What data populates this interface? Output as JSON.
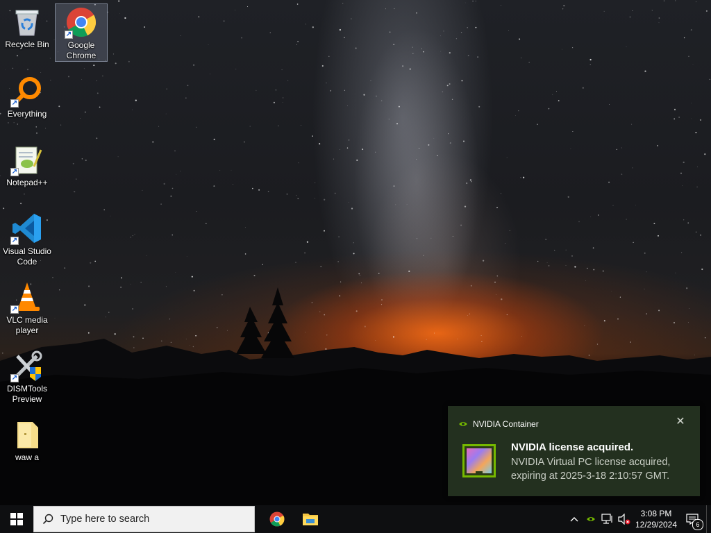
{
  "desktop": {
    "icons": [
      {
        "label": "Recycle Bin",
        "icon": "recycle-bin-icon"
      },
      {
        "label": "Google Chrome",
        "icon": "chrome-icon",
        "selected": true
      },
      {
        "label": "Everything",
        "icon": "everything-search-icon"
      },
      {
        "label": "Notepad++",
        "icon": "notepad-plus-plus-icon"
      },
      {
        "label": "Visual Studio Code",
        "icon": "vscode-icon"
      },
      {
        "label": "VLC media player",
        "icon": "vlc-icon"
      },
      {
        "label": "DISMTools Preview",
        "icon": "dismtools-icon"
      },
      {
        "label": "waw a",
        "icon": "folder-icon"
      }
    ]
  },
  "toast": {
    "app_name": "NVIDIA Container",
    "title": "NVIDIA license acquired.",
    "body": "NVIDIA Virtual PC license acquired, expiring at 2025-3-18 2:10:57 GMT.",
    "close_icon": "close-icon"
  },
  "taskbar": {
    "search_placeholder": "Type here to search",
    "pinned": [
      {
        "name": "Google Chrome",
        "icon": "chrome-icon"
      },
      {
        "name": "File Explorer",
        "icon": "file-explorer-icon"
      }
    ],
    "clock": {
      "time": "3:08 PM",
      "date": "12/29/2024"
    },
    "notification_count": "6",
    "accent": "#0078d7"
  }
}
